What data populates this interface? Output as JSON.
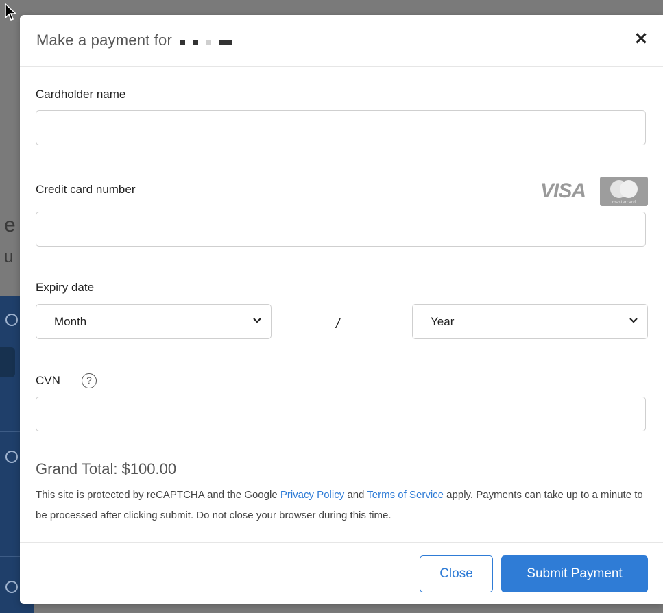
{
  "modal": {
    "title": "Make a payment for",
    "close_glyph": "×"
  },
  "form": {
    "cardholder_label": "Cardholder name",
    "cardholder_value": "",
    "card_number_label": "Credit card number",
    "card_number_value": "",
    "card_brands": {
      "visa_text": "VISA",
      "mastercard_text": "mastercard"
    },
    "expiry_label": "Expiry date",
    "month_select": {
      "selected": "Month"
    },
    "separator": "/",
    "year_select": {
      "selected": "Year"
    },
    "cvn_label": "CVN",
    "cvn_help_glyph": "?",
    "cvn_value": ""
  },
  "summary": {
    "grand_total": "Grand Total: $100.00",
    "notice_prefix": "This site is protected by reCAPTCHA and the Google ",
    "privacy_link": "Privacy Policy",
    "notice_and": " and ",
    "terms_link": "Terms of Service",
    "notice_suffix": " apply. Payments can take up to a minute to be processed after clicking submit. Do not close your browser during this time."
  },
  "footer": {
    "close_label": "Close",
    "submit_label": "Submit Payment"
  },
  "colors": {
    "accent": "#2f7cd6",
    "backdrop": "#767676",
    "sidebar": "#1f3f6a"
  }
}
